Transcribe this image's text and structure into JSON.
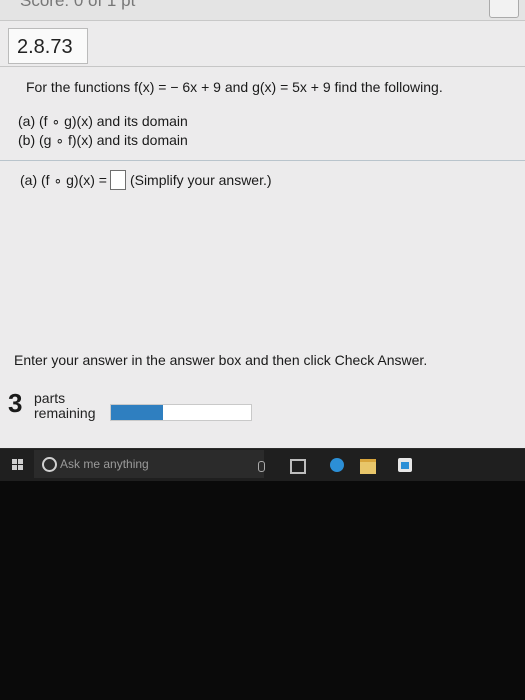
{
  "header": {
    "score_text": "Score: 0 of 1 pt",
    "question_id": "2.8.73"
  },
  "question": {
    "prompt": "For the functions f(x) = − 6x + 9 and g(x) = 5x + 9 find the following.",
    "part_a": "(a) (f ∘ g)(x) and its domain",
    "part_b": "(b) (g ∘ f)(x) and its domain"
  },
  "answer": {
    "label": "(a) (f ∘ g)(x) =",
    "value": "",
    "hint": "(Simplify your answer.)"
  },
  "footer": {
    "instruction": "Enter your answer in the answer box and then click Check Answer.",
    "parts_count": "3",
    "parts_word_1": "parts",
    "parts_word_2": "remaining",
    "progress_fraction": 0.37
  },
  "taskbar": {
    "search_placeholder": "Ask me anything",
    "icons": [
      "windows-start-icon",
      "microphone-icon",
      "task-view-icon",
      "edge-icon",
      "file-explorer-icon",
      "store-icon"
    ]
  },
  "colors": {
    "page_bg": "#ecebec",
    "progress": "#2f7fc0",
    "taskbar": "#1f1f1f",
    "outside": "#0a0a0a"
  }
}
